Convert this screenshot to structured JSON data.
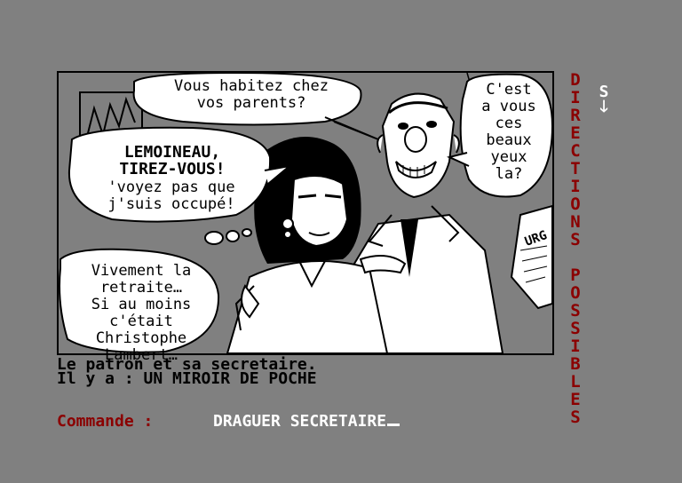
{
  "scene": {
    "bubbles": {
      "top": "Vous habitez chez\nvos parents?",
      "right": "C'est\na vous\nces\nbeaux\nyeux\nla?",
      "left_title": "LEMOINEAU,\nTIREZ-VOUS!",
      "left_body": "'voyez pas que\nj'suis occupé!",
      "thought": "Vivement la\nretraite…\nSi au moins\nc'était\nChristophe\nLambert…"
    },
    "paper_text": "URG"
  },
  "directions_label": [
    "D",
    "I",
    "R",
    "E",
    "C",
    "T",
    "I",
    "O",
    "N",
    "S",
    " ",
    "P",
    "O",
    "S",
    "S",
    "I",
    "B",
    "L",
    "E",
    "S"
  ],
  "exit": {
    "letter": "S",
    "arrow": "🡓"
  },
  "status": {
    "line1": "Le patron et sa secretaire.",
    "line2": "Il y a : UN MIROIR DE POCHE"
  },
  "command": {
    "label": "Commande :",
    "value": "DRAGUER SECRETAIRE"
  },
  "colors": {
    "background": "#808080",
    "label_red": "#8b0000",
    "input_white": "#ffffff"
  }
}
